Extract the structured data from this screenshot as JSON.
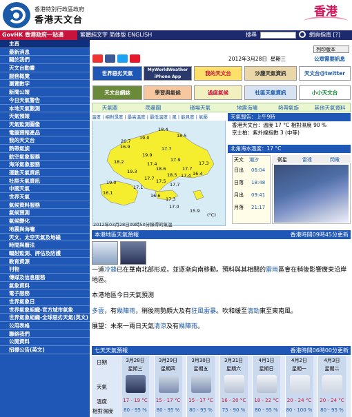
{
  "header": {
    "gov_name": "香港特別行政區政府",
    "obs_name": "香港天文台",
    "brand": "香港"
  },
  "govbar": {
    "govhk": "GovHK 香港政府一站通",
    "langs": "繁體純文字  简体版  ENGLISH",
    "search_label": "搜尋",
    "links": "網頁指南 [?]"
  },
  "sidebar": {
    "items": [
      "主頁",
      "最新消息",
      "關於我們",
      "天文台動畫",
      "服務概覽",
      "瀏覽數字",
      "新聞公報",
      "今日天氣警告",
      "本地天氣觀測",
      "天氣預報",
      "天氣監測圖像",
      "電腦預報產品",
      "我的天文台",
      "熱帶氣旋",
      "航空氣象服務",
      "海洋氣象服務",
      "運動天氣資訊",
      "社群天氣資訊",
      "中國天氣",
      "世界天氣",
      "氣候資料服務",
      "氣候預測",
      "氣候變化",
      "地震與海嘯",
      "天文、太空天氣及地磁",
      "時間與曆法",
      "輻射監測、評估及防護",
      "教育資源",
      "刊物",
      "傳媒及信息服務",
      "氣象資料",
      "電子服務",
      "世界氣象日",
      "世界氣象組織-官方城市氣象",
      "世界氣象組織-全球惡劣天氣(英文)",
      "公用表格",
      "聯絡我們",
      "公開資料",
      "招標公告(英文)"
    ]
  },
  "top": {
    "print_label": "列印版本",
    "date": "2012年3月28日",
    "weekday": "星期三",
    "quicknav": "公眾需要訊息"
  },
  "banners": [
    "世界惡劣天氣",
    "MyWorldWeather iPhone App",
    "我的天文台",
    "沙塵天氣資訊",
    "天文台@twitter",
    "天文台網誌",
    "學習與氣候",
    "過度氣候",
    "社區天氣資訊",
    "小小天文台"
  ],
  "tabs": [
    "天氣圖",
    "雨量圖",
    "穩場天氣",
    "地震海嘯",
    "熱帶氣旋",
    "其他天氣資料"
  ],
  "map": {
    "tabs": [
      "溫度",
      "相對濕度",
      "最高溫度",
      "最低溫度",
      "風",
      "能見度",
      "氣壓"
    ],
    "temps": [
      "18.4",
      "20.7",
      "19.0",
      "18.5",
      "16.9",
      "19.9",
      "18.2",
      "17.7",
      "17.3",
      "17.4",
      "18.6",
      "17.7",
      "19.3",
      "17.9",
      "18.5",
      "17.4",
      "17.7",
      "17.5",
      "16.4",
      "19.0",
      "16.1",
      "17.7",
      "17.3",
      "16.6",
      "17.1",
      "17.0",
      "15.9"
    ],
    "caption": "2012年03月28日09時50分錄得的氣溫",
    "unit": "(°C)"
  },
  "report": {
    "title": "天氣報告：上午9時",
    "line1": "香港天文台：溫度 17 °C  相對濕度 90 %",
    "line2": "京士柏：紫外線指數 3 (中等)",
    "sea": "北角海水溫度：17 °C"
  },
  "tide": {
    "tabs": [
      "天文",
      "潮汐"
    ],
    "rows": [
      [
        "日出",
        "06:04"
      ],
      [
        "日落",
        "18:48"
      ],
      [
        "月出",
        "09:41"
      ],
      [
        "月落",
        "21:17"
      ]
    ]
  },
  "radar": {
    "tabs": [
      "衛星",
      "雷達",
      "閃電"
    ]
  },
  "forecast": {
    "title": "本港地區天氣預報",
    "time": "香港時間09時45分更新",
    "p1a": "一道",
    "p1b": "冷鋒",
    "p1c": "已在華南北部形成，並逐漸向南移動。預料與其相關的",
    "p1d": "雷雨",
    "p1e": "區會在稍後影響廣東沿岸地區。",
    "p2": "本港地區今日天氣預測",
    "p3a": "多雲",
    "p3b": "，有",
    "p3c": "幾陣雨",
    "p3d": "，稍後雨勢頗大及有",
    "p3e": "狂風雷暴",
    "p3f": "。吹和緩至",
    "p3g": "清勁",
    "p3h": "東至東南風。",
    "p4a": "展望：未來一兩日天氣",
    "p4b": "清涼",
    "p4c": "及有",
    "p4d": "幾陣雨",
    "p4e": "。"
  },
  "seven": {
    "title": "七天天氣預報",
    "time": "香港時間06時00分更新",
    "labels": [
      "日期",
      "天氣",
      "溫度",
      "相對濕度"
    ],
    "days": [
      {
        "date": "3月28日",
        "wd": "星期三",
        "temp": "17 - 19 °C",
        "rh": "80 - 95 %",
        "icon": "thunderstorm-icon"
      },
      {
        "date": "3月29日",
        "wd": "星期四",
        "temp": "15 - 17 °C",
        "rh": "80 - 95 %",
        "icon": "rain-icon"
      },
      {
        "date": "3月30日",
        "wd": "星期五",
        "temp": "15 - 17 °C",
        "rh": "80 - 95 %",
        "icon": "rain-icon"
      },
      {
        "date": "3月31日",
        "wd": "星期六",
        "temp": "16 - 20 °C",
        "rh": "75 - 90 %",
        "icon": "cloudy-icon"
      },
      {
        "date": "4月1日",
        "wd": "星期日",
        "temp": "18 - 22 °C",
        "rh": "80 - 95 %",
        "icon": "cloudy-icon"
      },
      {
        "date": "4月2日",
        "wd": "星期一",
        "temp": "20 - 24 °C",
        "rh": "80 - 100 %",
        "icon": "fog-icon"
      },
      {
        "date": "4月3日",
        "wd": "星期二",
        "temp": "20 - 24 °C",
        "rh": "80 - 95 %",
        "icon": "fog-icon"
      }
    ]
  }
}
